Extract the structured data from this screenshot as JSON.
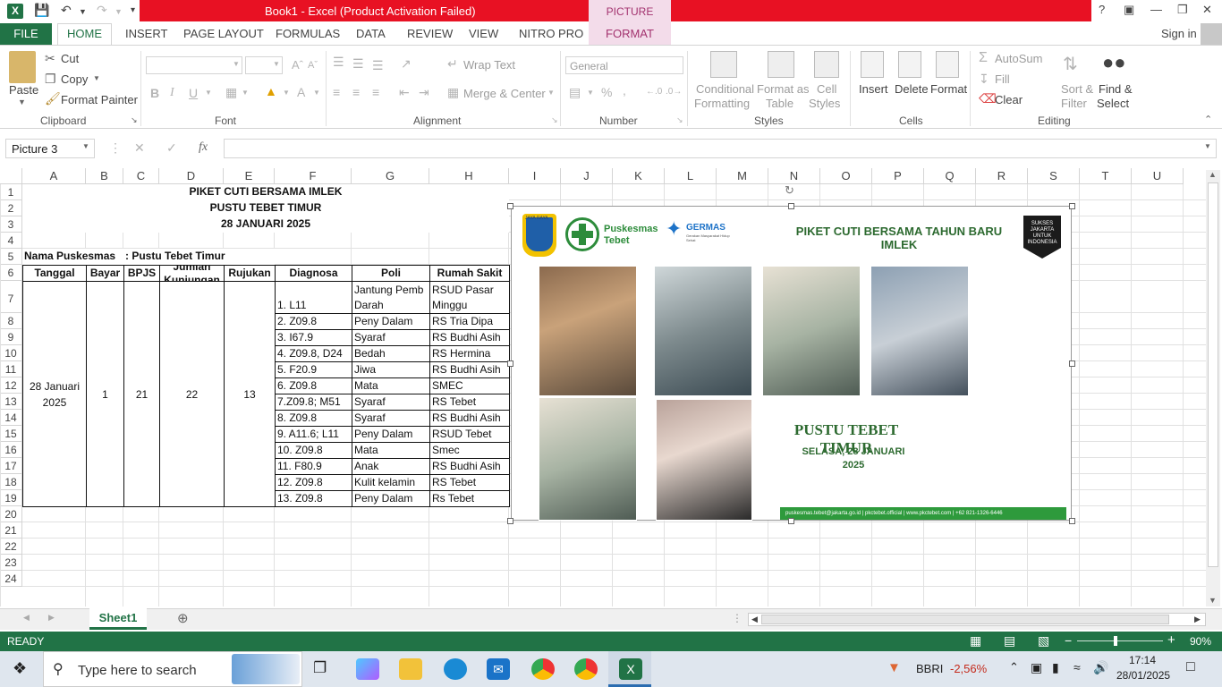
{
  "window": {
    "title": "Book1 -  Excel (Product Activation Failed)",
    "contextual_tools": "PICTURE TOOLS",
    "help": "?",
    "sign_in": "Sign in"
  },
  "tabs": [
    "FILE",
    "HOME",
    "INSERT",
    "PAGE LAYOUT",
    "FORMULAS",
    "DATA",
    "REVIEW",
    "VIEW",
    "NITRO PRO",
    "FORMAT"
  ],
  "ribbon": {
    "clipboard": {
      "paste": "Paste",
      "cut": "Cut",
      "copy": "Copy",
      "format_painter": "Format Painter",
      "group": "Clipboard"
    },
    "font": {
      "group": "Font",
      "bold": "B",
      "italic": "I",
      "underline": "U"
    },
    "alignment": {
      "wrap_text": "Wrap Text",
      "merge_center": "Merge & Center",
      "group": "Alignment"
    },
    "number": {
      "format": "General",
      "percent": "%",
      "comma": ",",
      "group": "Number"
    },
    "styles": {
      "conditional": "Conditional",
      "conditional2": "Formatting",
      "format_table": "Format as",
      "format_table2": "Table",
      "cell_styles": "Cell",
      "cell_styles2": "Styles",
      "group": "Styles"
    },
    "cells": {
      "insert": "Insert",
      "delete": "Delete",
      "format": "Format",
      "group": "Cells"
    },
    "editing": {
      "autosum": "AutoSum",
      "fill": "Fill",
      "clear": "Clear",
      "sort": "Sort &",
      "sort2": "Filter",
      "find": "Find &",
      "find2": "Select",
      "group": "Editing"
    }
  },
  "formula_bar": {
    "name_box": "Picture 3",
    "fx": "fx",
    "value": ""
  },
  "columns": [
    "A",
    "B",
    "C",
    "D",
    "E",
    "F",
    "G",
    "H",
    "I",
    "J",
    "K",
    "L",
    "M",
    "N",
    "O",
    "P",
    "Q",
    "R",
    "S",
    "T",
    "U"
  ],
  "rows": [
    "1",
    "2",
    "3",
    "4",
    "5",
    "6",
    "7",
    "8",
    "9",
    "10",
    "11",
    "12",
    "13",
    "14",
    "15",
    "16",
    "17",
    "18",
    "19",
    "20",
    "21",
    "22",
    "23",
    "24"
  ],
  "sheet": {
    "title1": "PIKET CUTI BERSAMA IMLEK",
    "title2": "PUSTU TEBET TIMUR",
    "title3": "28 JANUARI 2025",
    "nama_label": "Nama Puskesmas",
    "nama_value": ": Pustu Tebet Timur",
    "headers": [
      "Tanggal",
      "Bayar",
      "BPJS",
      "Jumlah Kunjungan",
      "Rujukan",
      "Diagnosa",
      "Poli",
      "Rumah Sakit"
    ],
    "tanggal": "28 Januari 2025",
    "bayar": "1",
    "bpjs": "21",
    "kunjungan": "22",
    "rujukan": "13",
    "diagnosa": [
      "1. L11",
      "2. Z09.8",
      "3. I67.9",
      "4. Z09.8, D24",
      "5. F20.9",
      "6. Z09.8",
      "7.Z09.8; M51",
      "8. Z09.8",
      "9. A11.6; L11",
      "10. Z09.8",
      "11. F80.9",
      "12. Z09.8",
      "13.  Z09.8"
    ],
    "poli": [
      "Jantung Pemb Darah",
      "Peny Dalam",
      "Syaraf",
      "Bedah",
      "Jiwa",
      "Mata",
      "Syaraf",
      "Syaraf",
      "Peny Dalam",
      "Mata",
      "Anak",
      "Kulit kelamin",
      "Peny Dalam"
    ],
    "rs": [
      "RSUD Pasar Minggu",
      "RS Tria Dipa",
      "RS Budhi Asih",
      "RS Hermina",
      "RS Budhi Asih",
      "SMEC",
      "RS Tebet",
      "RS Budhi Asih",
      "RSUD Tebet",
      "Smec",
      "RS Budhi Asih",
      "RS Tebet",
      "Rs Tebet"
    ]
  },
  "picture": {
    "logo_jaya": "JAYA RAYA",
    "puskesmas": "Puskesmas",
    "puskesmas2": "Tebet",
    "germas": "GERMAS",
    "germas_sub": "Gerakan Masyarakat Hidup Sehat",
    "headline1": "PIKET CUTI BERSAMA TAHUN BARU",
    "headline2": "IMLEK",
    "sukses": "SUKSES JAKARTA UNTUK INDONESIA",
    "pustu": "PUSTU TEBET TIMUR",
    "date1": "SELASA, 28 JANUARI",
    "date2": "2025",
    "footer": "puskesmas.tebet@jakarta.go.id   |   pkctebet.official   |   www.pkctebet.com   |   +62 821-1326-6446"
  },
  "sheet_tab": "Sheet1",
  "status": {
    "ready": "READY",
    "zoom": "90%"
  },
  "taskbar": {
    "search": "Type here to search",
    "stock_name": "BBRI",
    "stock_change": "-2,56%",
    "time": "17:14",
    "date": "28/01/2025"
  },
  "colors": {
    "excel_green": "#217346",
    "error_red": "#e81123",
    "picture_tools": "#f3dcea"
  }
}
